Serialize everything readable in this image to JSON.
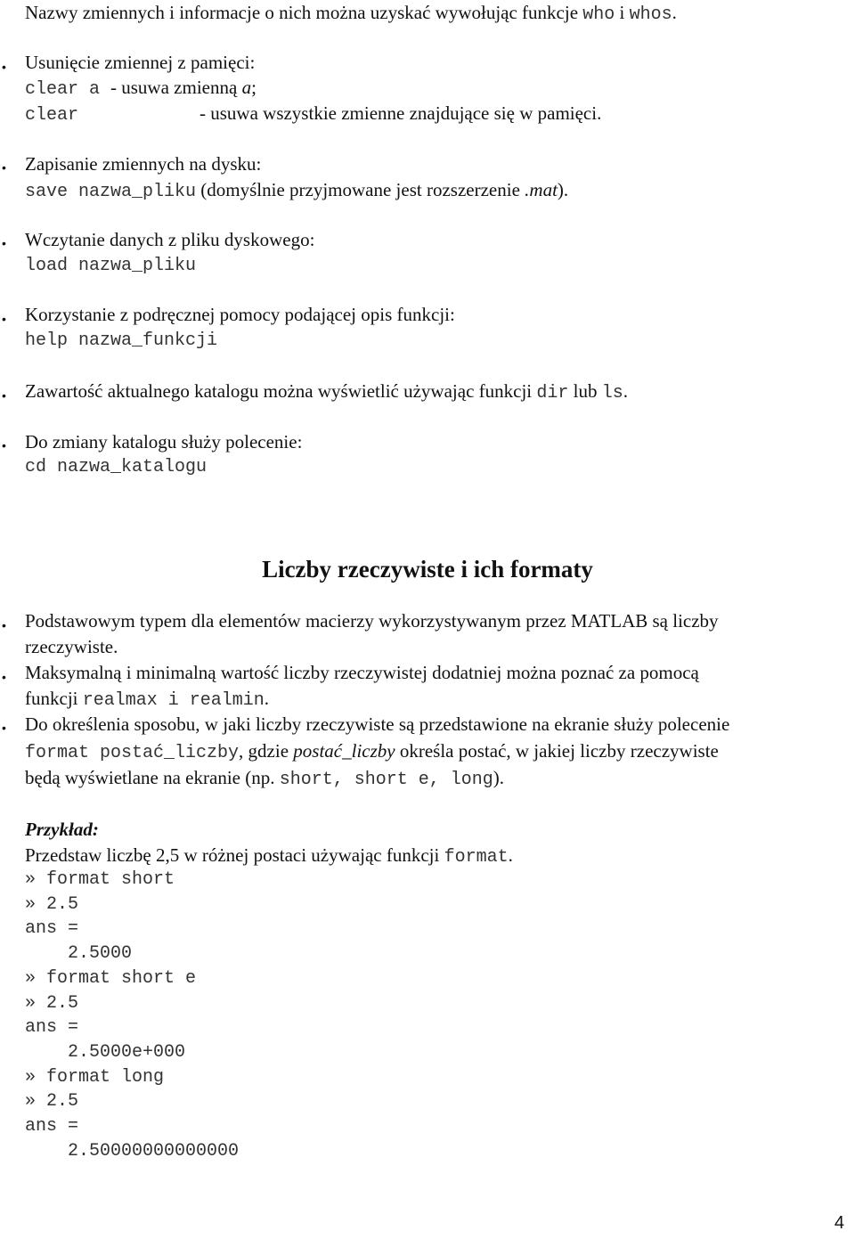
{
  "intro": {
    "text_before": "Nazwy zmiennych i informacje o nich można uzyskać wywołując funkcje ",
    "cmd1": "who",
    "and": " i ",
    "cmd2": "whos",
    "end": "."
  },
  "bullets_top": [
    {
      "heading": "Usunięcie zmiennej z pamięci:",
      "lines": [
        {
          "code": "clear a",
          "desc": "- usuwa zmienną ",
          "desc_italic": "a",
          "desc_end": ";"
        },
        {
          "code": "clear",
          "desc": "- usuwa wszystkie zmienne znajdujące się w pamięci."
        }
      ]
    },
    {
      "heading": "Zapisanie zmiennych na dysku:",
      "code": "save nazwa_pliku",
      "desc": " (domyślnie przyjmowane jest rozszerzenie ",
      "desc_italic": ".mat",
      "desc_end": ")."
    },
    {
      "heading": "Wczytanie danych z pliku dyskowego:",
      "code": "load nazwa_pliku"
    },
    {
      "heading": "Korzystanie z podręcznej pomocy podającej opis funkcji:",
      "code": "help nazwa_funkcji"
    },
    {
      "text": "Zawartość aktualnego katalogu można wyświetlić używając funkcji ",
      "code1": "dir",
      "mid": " lub ",
      "code2": "ls",
      "end": "."
    },
    {
      "heading": "Do zmiany katalogu służy polecenie:",
      "code": "cd nazwa_katalogu"
    }
  ],
  "section_title": "Liczby rzeczywiste i ich formaty",
  "bullets_section": [
    {
      "line1": "Podstawowym typem dla elementów macierzy wykorzystywanym przez MATLAB są liczby",
      "line2": "rzeczywiste."
    },
    {
      "line1": "Maksymalną i minimalną wartość liczby rzeczywistej dodatniej można poznać za pomocą",
      "line2_text": "funkcji ",
      "line2_code": "realmax i realmin",
      "line2_end": "."
    },
    {
      "line1": "Do określenia sposobu, w jaki liczby rzeczywiste są przedstawione na ekranie służy polecenie",
      "line2_code": "format postać_liczby",
      "line2_text": ", gdzie ",
      "line2_italic": "postać_liczby",
      "line2_end": " określa postać, w jakiej liczby rzeczywiste",
      "line3_text": "będą wyświetlane na ekranie (np. ",
      "line3_code": "short, short e, long",
      "line3_end": ")."
    }
  ],
  "example": {
    "title": "Przykład:",
    "intro_text": "Przedstaw liczbę 2,5 w różnej postaci używając funkcji ",
    "intro_code": "format",
    "intro_end": ".",
    "console": [
      "» format short",
      "» 2.5",
      "ans =",
      "    2.5000",
      "» format short e",
      "» 2.5",
      "ans =",
      "    2.5000e+000",
      "» format long",
      "» 2.5",
      "ans =",
      "    2.50000000000000"
    ]
  },
  "page_number": "4"
}
